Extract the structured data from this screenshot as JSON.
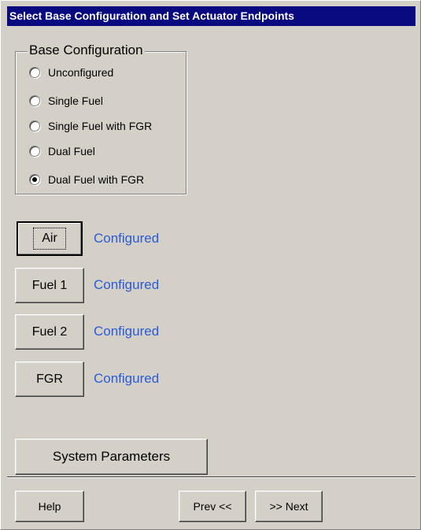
{
  "window": {
    "title": "Select Base Configuration and Set Actuator Endpoints"
  },
  "base_configuration": {
    "legend": "Base Configuration",
    "options": [
      {
        "label": "Unconfigured",
        "selected": false
      },
      {
        "label": "Single Fuel",
        "selected": false
      },
      {
        "label": "Single Fuel with FGR",
        "selected": false
      },
      {
        "label": "Dual Fuel",
        "selected": false
      },
      {
        "label": "Dual Fuel with FGR",
        "selected": true
      }
    ]
  },
  "actuators": [
    {
      "button": "Air",
      "status": "Configured"
    },
    {
      "button": "Fuel 1",
      "status": "Configured"
    },
    {
      "button": "Fuel 2",
      "status": "Configured"
    },
    {
      "button": "FGR",
      "status": "Configured"
    }
  ],
  "system_parameters_button": "System Parameters",
  "footer": {
    "help": "Help",
    "prev": "Prev <<",
    "next": ">> Next"
  },
  "colors": {
    "title_bar": "#0a0a80",
    "status_text": "#2a5bd7",
    "face": "#d4d0c8"
  }
}
